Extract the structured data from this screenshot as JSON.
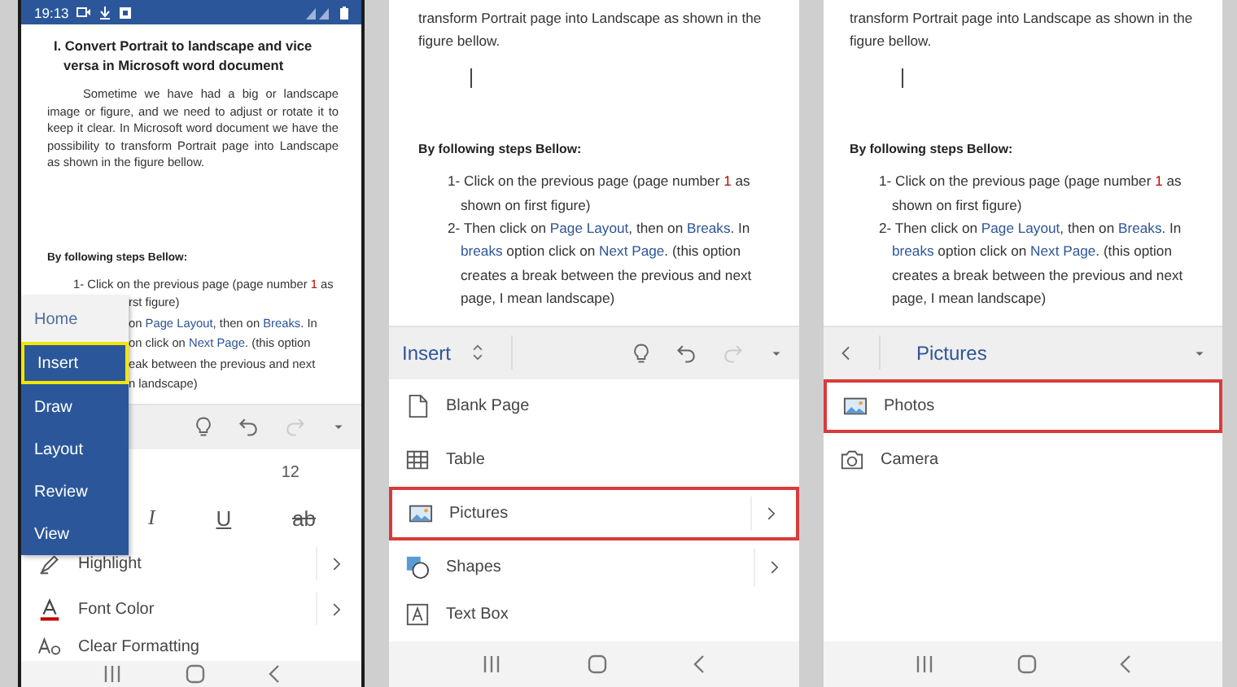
{
  "screens": [
    {
      "status_bar": {
        "time": "19:13"
      },
      "document": {
        "blocks": [
          {
            "kind": "title",
            "text": "I. Convert Portrait to landscape and vice versa in Microsoft word document"
          },
          {
            "kind": "paragraph",
            "text": "Sometime we have had a big or landscape image or figure, and we need to adjust or rotate it to keep it clear. In Microsoft word document we have the possibility to transform Portrait page into Landscape as shown in the figure bellow."
          },
          {
            "kind": "subheading",
            "text": "By following steps Bellow:"
          },
          {
            "kind": "step",
            "segments": [
              {
                "kind": "plain",
                "text": "1- Click on the previous page (page number "
              },
              {
                "kind": "number",
                "text": "1"
              },
              {
                "kind": "plain",
                "text": " as"
              }
            ]
          },
          {
            "kind": "covered",
            "segments": [
              {
                "kind": "plain",
                "text": "rst figure)"
              }
            ]
          },
          {
            "kind": "covered",
            "segments": [
              {
                "kind": "plain",
                "text": "on "
              },
              {
                "kind": "link",
                "text": "Page Layout"
              },
              {
                "kind": "plain",
                "text": ", then on "
              },
              {
                "kind": "link",
                "text": "Breaks"
              },
              {
                "kind": "plain",
                "text": ". In"
              }
            ]
          },
          {
            "kind": "covered",
            "segments": [
              {
                "kind": "plain",
                "text": "on click on "
              },
              {
                "kind": "link",
                "text": "Next Page"
              },
              {
                "kind": "plain",
                "text": ".  (this option"
              }
            ]
          },
          {
            "kind": "covered",
            "segments": [
              {
                "kind": "plain",
                "text": "eak between the previous and next"
              }
            ]
          },
          {
            "kind": "covered",
            "segments": [
              {
                "kind": "plain",
                "text": "n landscape)"
              }
            ]
          }
        ]
      },
      "toolbar": {
        "kind": "tools",
        "redo_disabled": true
      },
      "font_size": "12",
      "format_buttons": [
        {
          "kind": "italic",
          "label": "I"
        },
        {
          "kind": "underline",
          "label": "U"
        },
        {
          "kind": "strikethrough",
          "label": "ab"
        }
      ],
      "commands": [
        {
          "kind": "highlight",
          "label": "Highlight",
          "submenu": true,
          "outlined": false
        },
        {
          "kind": "font_color",
          "label": "Font Color",
          "submenu": true,
          "outlined": false
        },
        {
          "kind": "clear_formatting",
          "label": "Clear Formatting",
          "submenu": false,
          "outlined": false
        }
      ],
      "tab_menu": [
        {
          "label": "Home",
          "current": true,
          "selected": false
        },
        {
          "label": "Insert",
          "current": false,
          "selected": true
        },
        {
          "label": "Draw",
          "current": false,
          "selected": false
        },
        {
          "label": "Layout",
          "current": false,
          "selected": false
        },
        {
          "label": "Review",
          "current": false,
          "selected": false
        },
        {
          "label": "View",
          "current": false,
          "selected": false
        }
      ]
    },
    {
      "document": {
        "blocks": [
          {
            "kind": "text",
            "text": "transform Portrait page into Landscape as shown in the figure bellow."
          },
          {
            "kind": "cursor"
          },
          {
            "kind": "subheading",
            "text": "By following steps Bellow:"
          },
          {
            "kind": "step",
            "segments": [
              {
                "kind": "plain",
                "text": "1- Click on the previous page (page number "
              },
              {
                "kind": "number",
                "text": "1"
              },
              {
                "kind": "plain",
                "text": " as shown on first figure)"
              }
            ]
          },
          {
            "kind": "step",
            "segments": [
              {
                "kind": "plain",
                "text": "2- Then click on "
              },
              {
                "kind": "link",
                "text": "Page Layout"
              },
              {
                "kind": "plain",
                "text": ", then on "
              },
              {
                "kind": "link",
                "text": "Breaks"
              },
              {
                "kind": "plain",
                "text": ". In "
              },
              {
                "kind": "link",
                "text": "breaks"
              },
              {
                "kind": "plain",
                "text": " option click on "
              },
              {
                "kind": "link",
                "text": "Next Page"
              },
              {
                "kind": "plain",
                "text": ".  (this option creates a break between the previous and next page, I mean landscape)"
              }
            ]
          }
        ]
      },
      "toolbar": {
        "kind": "tab",
        "label": "Insert",
        "redo_disabled": true
      },
      "commands": [
        {
          "kind": "blank_page",
          "label": "Blank Page",
          "submenu": false,
          "outlined": false
        },
        {
          "kind": "table",
          "label": "Table",
          "submenu": false,
          "outlined": false
        },
        {
          "kind": "pictures",
          "label": "Pictures",
          "submenu": true,
          "outlined": true
        },
        {
          "kind": "shapes",
          "label": "Shapes",
          "submenu": true,
          "outlined": false
        },
        {
          "kind": "text_box",
          "label": "Text Box",
          "submenu": false,
          "outlined": false
        }
      ]
    },
    {
      "document": {
        "blocks": [
          {
            "kind": "text",
            "text": "transform Portrait page into Landscape as shown in the figure bellow."
          },
          {
            "kind": "cursor"
          },
          {
            "kind": "subheading",
            "text": "By following steps Bellow:"
          },
          {
            "kind": "step",
            "segments": [
              {
                "kind": "plain",
                "text": "1- Click on the previous page (page number "
              },
              {
                "kind": "number",
                "text": "1"
              },
              {
                "kind": "plain",
                "text": " as shown on first figure)"
              }
            ]
          },
          {
            "kind": "step",
            "segments": [
              {
                "kind": "plain",
                "text": "2- Then click on "
              },
              {
                "kind": "link",
                "text": "Page Layout"
              },
              {
                "kind": "plain",
                "text": ", then on "
              },
              {
                "kind": "link",
                "text": "Breaks"
              },
              {
                "kind": "plain",
                "text": ". In "
              },
              {
                "kind": "link",
                "text": "breaks"
              },
              {
                "kind": "plain",
                "text": " option click on "
              },
              {
                "kind": "link",
                "text": "Next Page"
              },
              {
                "kind": "plain",
                "text": ".  (this option creates a break between the previous and next page, I mean landscape)"
              }
            ]
          }
        ]
      },
      "toolbar": {
        "kind": "submenu",
        "label": "Pictures"
      },
      "commands": [
        {
          "kind": "photos",
          "label": "Photos",
          "submenu": false,
          "outlined": true
        },
        {
          "kind": "camera",
          "label": "Camera",
          "submenu": false,
          "outlined": false
        }
      ]
    }
  ]
}
